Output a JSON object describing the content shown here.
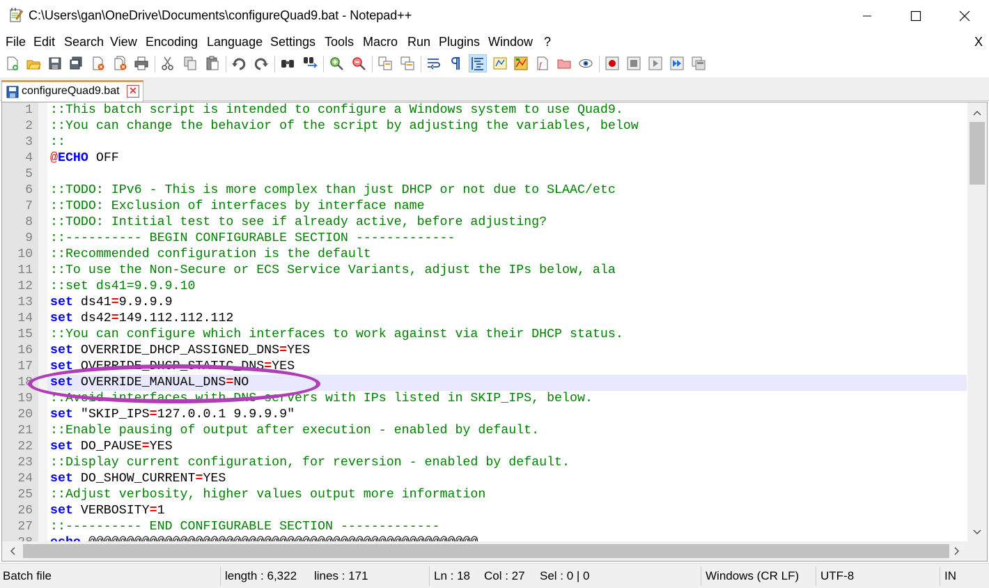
{
  "window": {
    "title": "C:\\Users\\gan\\OneDrive\\Documents\\configureQuad9.bat - Notepad++"
  },
  "menu": {
    "items": [
      "File",
      "Edit",
      "Search",
      "View",
      "Encoding",
      "Language",
      "Settings",
      "Tools",
      "Macro",
      "Run",
      "Plugins",
      "Window",
      "?"
    ],
    "close_x": "X"
  },
  "toolbar": {
    "buttons": [
      "new-file-icon",
      "open-file-icon",
      "save-icon",
      "save-all-icon",
      "close-icon",
      "close-all-icon",
      "print-icon",
      "cut-icon",
      "copy-icon",
      "paste-icon",
      "undo-icon",
      "redo-icon",
      "find-icon",
      "replace-icon",
      "zoom-in-icon",
      "zoom-out-icon",
      "sync-vertical-icon",
      "sync-horizontal-icon",
      "word-wrap-icon",
      "show-all-characters-icon",
      "indent-guide-icon",
      "udl-icon",
      "document-map-icon",
      "function-list-icon",
      "folder-as-workspace-icon",
      "monitoring-icon",
      "record-macro-icon",
      "stop-recording-icon",
      "playback-macro-icon",
      "run-macro-multiple-icon",
      "save-macro-icon"
    ],
    "active": "indent-guide-icon"
  },
  "tabs": [
    {
      "label": "configureQuad9.bat",
      "close_symbol": "✕"
    }
  ],
  "editor": {
    "current_line": 18,
    "lines": [
      {
        "n": "1",
        "kind": "comment",
        "text": "::This batch script is intended to configure a Windows system to use Quad9."
      },
      {
        "n": "2",
        "kind": "comment",
        "text": "::You can change the behavior of the script by adjusting the variables, below"
      },
      {
        "n": "3",
        "kind": "comment",
        "text": "::"
      },
      {
        "n": "4",
        "kind": "echo",
        "at": "@",
        "kw": "ECHO",
        "text": " OFF"
      },
      {
        "n": "5",
        "kind": "blank",
        "text": ""
      },
      {
        "n": "6",
        "kind": "comment",
        "text": "::TODO: IPv6 - This is more complex than just DHCP or not due to SLAAC/etc"
      },
      {
        "n": "7",
        "kind": "comment",
        "text": "::TODO: Exclusion of interfaces by interface name"
      },
      {
        "n": "8",
        "kind": "comment",
        "text": "::TODO: Intitial test to see if already active, before adjusting?"
      },
      {
        "n": "9",
        "kind": "comment",
        "text": "::---------- BEGIN CONFIGURABLE SECTION -------------"
      },
      {
        "n": "10",
        "kind": "comment",
        "text": "::Recommended configuration is the default"
      },
      {
        "n": "11",
        "kind": "comment",
        "text": "::To use the Non-Secure or ECS Service Variants, adjust the IPs below, ala"
      },
      {
        "n": "12",
        "kind": "comment",
        "text": "::set ds41=9.9.9.10"
      },
      {
        "n": "13",
        "kind": "set",
        "kw": "set",
        "var": " ds41",
        "op": "=",
        "val": "9.9.9.9"
      },
      {
        "n": "14",
        "kind": "set",
        "kw": "set",
        "var": " ds42",
        "op": "=",
        "val": "149.112.112.112"
      },
      {
        "n": "15",
        "kind": "comment",
        "text": "::You can configure which interfaces to work against via their DHCP status."
      },
      {
        "n": "16",
        "kind": "set",
        "kw": "set",
        "var": " OVERRIDE_DHCP_ASSIGNED_DNS",
        "op": "=",
        "val": "YES"
      },
      {
        "n": "17",
        "kind": "set",
        "kw": "set",
        "var": " OVERRIDE_DHCP_STATIC_DNS",
        "op": "=",
        "val": "YES"
      },
      {
        "n": "18",
        "kind": "set",
        "kw": "set",
        "var": " OVERRIDE_MANUAL_DNS",
        "op": "=",
        "val": "NO"
      },
      {
        "n": "19",
        "kind": "comment",
        "text": "::Avoid interfaces with DNS servers with IPs listed in SKIP_IPS, below."
      },
      {
        "n": "20",
        "kind": "set",
        "kw": "set",
        "var": " \"SKIP_IPS",
        "op": "=",
        "val": "127.0.0.1 9.9.9.9\""
      },
      {
        "n": "21",
        "kind": "comment",
        "text": "::Enable pausing of output after execution - enabled by default."
      },
      {
        "n": "22",
        "kind": "set",
        "kw": "set",
        "var": " DO_PAUSE",
        "op": "=",
        "val": "YES"
      },
      {
        "n": "23",
        "kind": "comment",
        "text": "::Display current configuration, for reversion - enabled by default."
      },
      {
        "n": "24",
        "kind": "set",
        "kw": "set",
        "var": " DO_SHOW_CURRENT",
        "op": "=",
        "val": "YES"
      },
      {
        "n": "25",
        "kind": "comment",
        "text": "::Adjust verbosity, higher values output more information"
      },
      {
        "n": "26",
        "kind": "set",
        "kw": "set",
        "var": " VERBOSITY",
        "op": "=",
        "val": "1"
      },
      {
        "n": "27",
        "kind": "comment",
        "text": "::---------- END CONFIGURABLE SECTION -------------"
      },
      {
        "n": "28",
        "kind": "echo-partial",
        "kw": "echo",
        "text": " @@@@@@@@@@@@@@@@@@@@@@@@@@@@@@@@@@@@@@@@@@@@@@@@@@@"
      }
    ]
  },
  "annotation": {
    "highlight_color": "#b03cb8",
    "target_line": 18
  },
  "statusbar": {
    "file_type": "Batch file",
    "length": "length : 6,322",
    "lines": "lines : 171",
    "ln": "Ln : 18",
    "col": "Col : 27",
    "sel": "Sel : 0 | 0",
    "eol": "Windows (CR LF)",
    "encoding": "UTF-8",
    "mode": "IN"
  },
  "colors": {
    "comment": "#008000",
    "keyword": "#0000ff",
    "operator": "#ff0000",
    "current_line_bg": "#e8e8ff"
  }
}
